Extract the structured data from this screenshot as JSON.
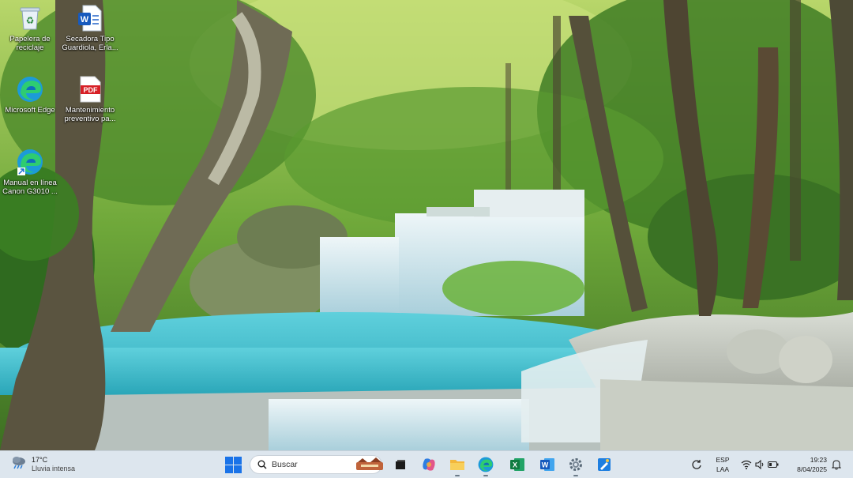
{
  "desktop": {
    "icons": [
      {
        "label": "Papelera de reciclaje",
        "icon": "recycle-bin-icon"
      },
      {
        "label": "Secadora Tipo Guardiola, Erla...",
        "icon": "word-document-icon"
      },
      {
        "label": "Microsoft Edge",
        "icon": "edge-icon"
      },
      {
        "label": "Mantenimiento preventivo pa...",
        "icon": "pdf-document-icon"
      },
      {
        "label": "Manual en línea Canon G3010 ...",
        "icon": "edge-icon"
      }
    ]
  },
  "taskbar": {
    "weather": {
      "temperature": "17°C",
      "condition": "Lluvia intensa",
      "icon": "weather-icon"
    },
    "search": {
      "placeholder": "Buscar"
    },
    "apps": [
      {
        "name": "Task View",
        "icon": "task-view-icon"
      },
      {
        "name": "Copilot",
        "icon": "copilot-icon"
      },
      {
        "name": "File Explorer",
        "icon": "file-explorer-icon"
      },
      {
        "name": "Microsoft Edge",
        "icon": "edge-icon"
      },
      {
        "name": "Excel",
        "icon": "excel-icon"
      },
      {
        "name": "Word",
        "icon": "word-icon"
      },
      {
        "name": "Settings",
        "icon": "gear-icon"
      },
      {
        "name": "Paint",
        "icon": "paint-icon"
      }
    ],
    "tray": {
      "language_line1": "ESP",
      "language_line2": "LAA",
      "time": "19:23",
      "date": "8/04/2025"
    }
  },
  "colors": {
    "taskbar_bg": "#dde6ee",
    "water": "#3cb7c6",
    "foliage": "#4f8f2e"
  }
}
